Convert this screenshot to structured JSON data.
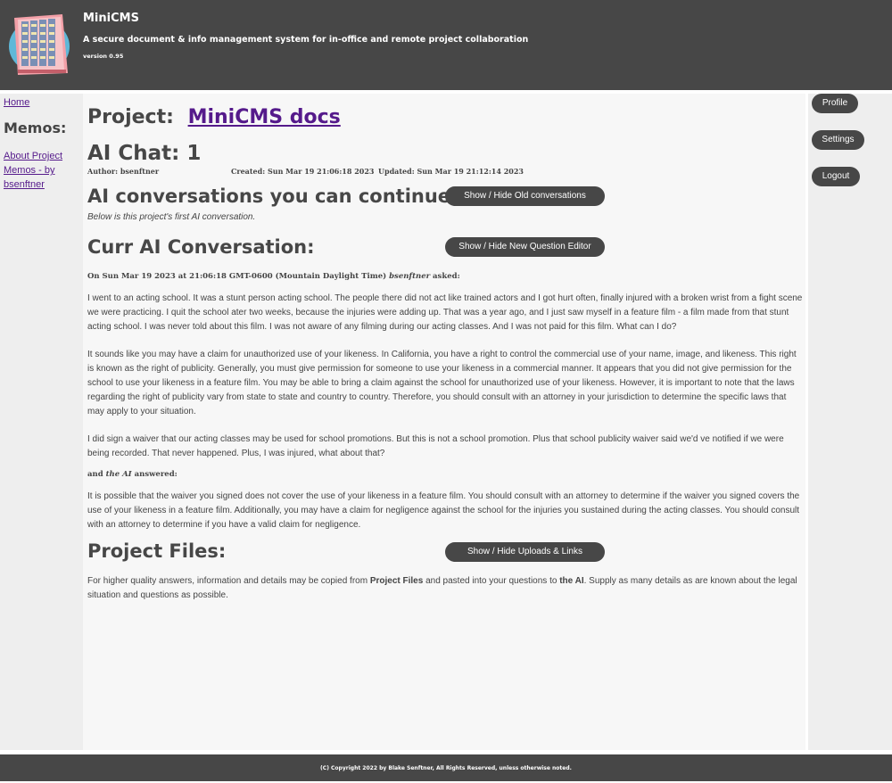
{
  "header": {
    "title": "MiniCMS",
    "tagline": "A secure document & info management system for in-office and remote project collaboration",
    "version": "version 0.95"
  },
  "left_sidebar": {
    "home_label": "Home",
    "memos_title": "Memos:",
    "memo_link_label": "About Project Memos - by bsenftner"
  },
  "main": {
    "project_prefix": "Project:",
    "project_name": "MiniCMS docs",
    "chat_title": "AI Chat: 1",
    "author": "Author: bsenftner",
    "created": "Created: Sun Mar 19 21:06:18 2023",
    "updated": "Updated: Sun Mar 19 21:12:14 2023",
    "continue_heading": "AI conversations you can continue:",
    "old_conv_button": "Show / Hide Old conversations",
    "first_conv_note": "Below is this project's first AI conversation.",
    "curr_heading": "Curr AI Conversation:",
    "new_question_button": "Show / Hide New Question Editor",
    "asked_prefix": "On Sun Mar 19 2023 at 21:06:18 GMT-0600 (Mountain Daylight Time)",
    "asked_user": "bsenftner",
    "asked_suffix": "asked:",
    "question_1": "I went to an acting school. It was a stunt person acting school. The people there did not act like trained actors and I got hurt often, finally injured with a broken wrist from a fight scene we were practicing. I quit the school ater two weeks, because the injuries were adding up. That was a year ago, and I just saw myself in a feature film - a film made from that stunt acting school. I was never told about this film. I was not aware of any filming during our acting classes. And I was not paid for this film. What can I do?",
    "answer_1": "It sounds like you may have a claim for unauthorized use of your likeness. In California, you have a right to control the commercial use of your name, image, and likeness. This right is known as the right of publicity. Generally, you must give permission for someone to use your likeness in a commercial manner. It appears that you did not give permission for the school to use your likeness in a feature film. You may be able to bring a claim against the school for unauthorized use of your likeness. However, it is important to note that the laws regarding the right of publicity vary from state to state and country to country. Therefore, you should consult with an attorney in your jurisdiction to determine the specific laws that may apply to your situation.",
    "question_2": "I did sign a waiver that our acting classes may be used for school promotions. But this is not a school promotion. Plus that school publicity waiver said we'd ve notified if we were being recorded. That never happened. Plus, I was injured, what about that?",
    "answered_prefix": "and",
    "answered_who": "the AI",
    "answered_suffix": "answered:",
    "answer_2": "It is possible that the waiver you signed does not cover the use of your likeness in a feature film. You should consult with an attorney to determine if the waiver you signed covers the use of your likeness in a feature film. Additionally, you may have a claim for negligence against the school for the injuries you sustained during the acting classes. You should consult with an attorney to determine if you have a valid claim for negligence.",
    "files_heading": "Project Files:",
    "uploads_button": "Show / Hide Uploads & Links",
    "files_text_1": "For higher quality answers, information and details may be copied from",
    "files_bold_1": "Project Files",
    "files_text_2": "and pasted into your questions to",
    "files_bold_2": "the AI",
    "files_text_3": ". Supply as many details as are known about the legal situation and questions as possible."
  },
  "right_sidebar": {
    "profile_label": "Profile",
    "settings_label": "Settings",
    "logout_label": "Logout"
  },
  "footer": {
    "copyright": "(C) Copyright 2022 by Blake Senftner, All Rights Reserved, unless otherwise noted."
  },
  "colors": {
    "header_bg": "#474747",
    "sidebar_bg": "#eeeeee",
    "main_bg": "#f7f7f7",
    "link": "#551a8b",
    "button_bg": "#474747"
  }
}
